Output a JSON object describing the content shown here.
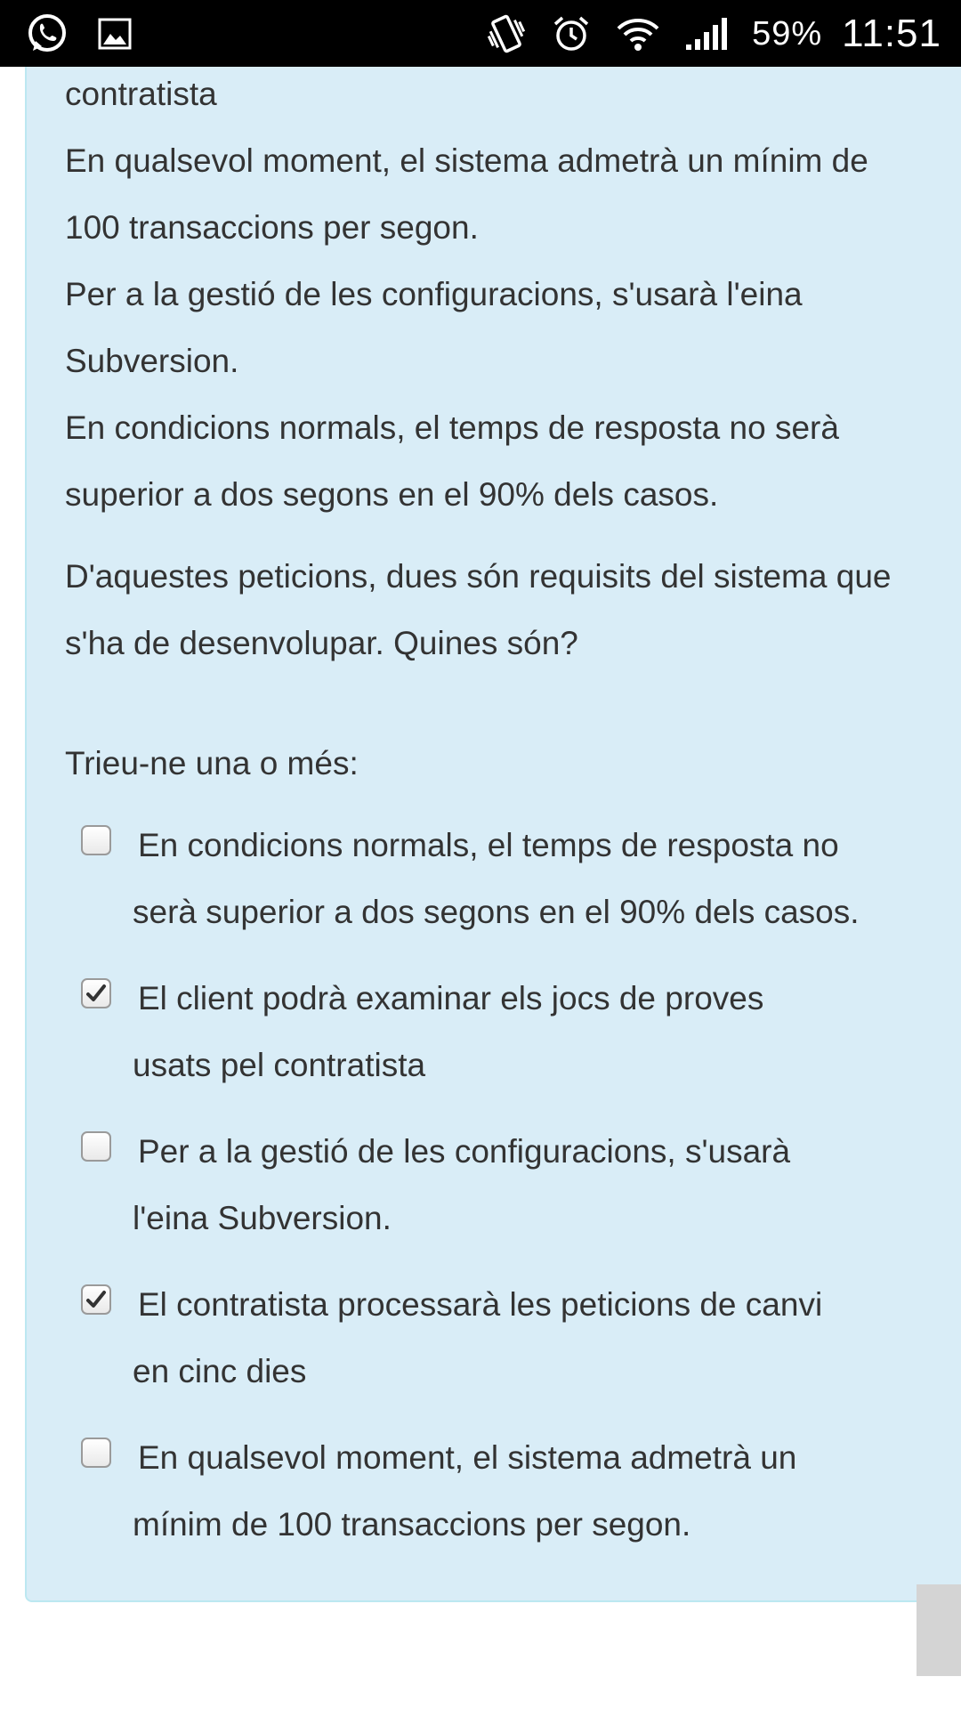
{
  "status_bar": {
    "battery": "59%",
    "time": "11:51",
    "left_icons": [
      "whatsapp-icon",
      "gallery-icon"
    ],
    "right_icons": [
      "vibrate-icon",
      "alarm-icon",
      "wifi-icon",
      "signal-icon"
    ]
  },
  "question": {
    "lines": [
      "contratista",
      "En qualsevol moment, el sistema admetrà un mínim de",
      "100 transaccions per segon.",
      "Per a la gestió de les configuracions, s'usarà l'eina",
      "Subversion.",
      "En condicions normals, el temps de resposta no serà",
      "superior a dos segons en el 90% dels casos."
    ],
    "prompt_lines": [
      "D'aquestes peticions, dues són requisits del sistema que",
      "s'ha de desenvolupar. Quines són?"
    ],
    "instruction": "Trieu-ne una o més:"
  },
  "options": [
    {
      "line1": "En condicions normals, el temps de resposta no",
      "line2": "serà superior a dos segons en el 90% dels casos.",
      "checked": false
    },
    {
      "line1": "El client podrà examinar els jocs de proves",
      "line2": "usats pel contratista",
      "checked": true
    },
    {
      "line1": "Per a la gestió de les configuracions, s'usarà",
      "line2": "l'eina Subversion.",
      "checked": false
    },
    {
      "line1": "El contratista processarà les peticions de canvi",
      "line2": "en cinc dies",
      "checked": true
    },
    {
      "line1": "En qualsevol moment, el sistema admetrà un",
      "line2": "mínim de 100 transaccions per segon.",
      "checked": false
    }
  ],
  "colors": {
    "panel_bg": "#d9edf7",
    "panel_border": "#bce8f1",
    "text": "#333333",
    "status_bar_bg": "#000000"
  }
}
